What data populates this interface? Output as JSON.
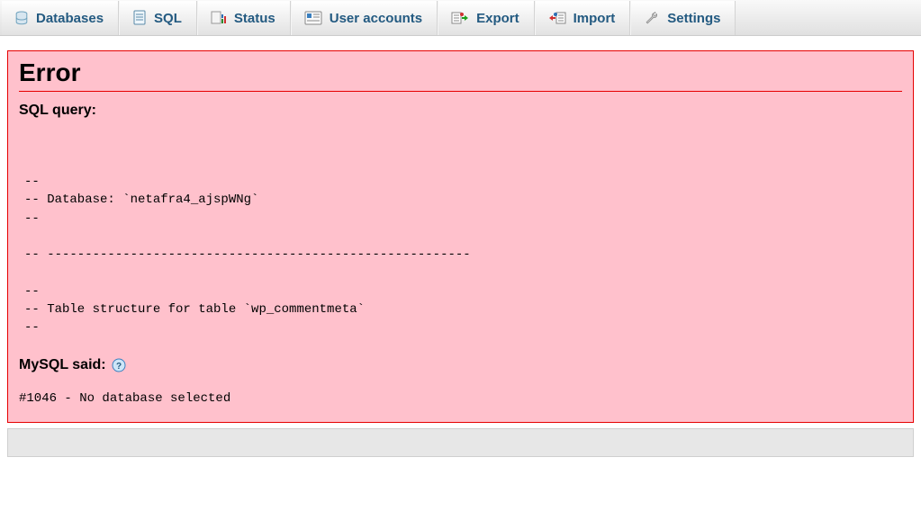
{
  "tabs": [
    {
      "id": "databases",
      "label": "Databases"
    },
    {
      "id": "sql",
      "label": "SQL"
    },
    {
      "id": "status",
      "label": "Status"
    },
    {
      "id": "useraccounts",
      "label": "User accounts"
    },
    {
      "id": "export",
      "label": "Export"
    },
    {
      "id": "import",
      "label": "Import"
    },
    {
      "id": "settings",
      "label": "Settings"
    }
  ],
  "error": {
    "heading": "Error",
    "sql_query_label": "SQL query:",
    "sql_text": "--\n-- Database: `netafra4_ajspWNg`\n--\n\n-- --------------------------------------------------------\n\n--\n-- Table structure for table `wp_commentmeta`\n--",
    "mysql_said_label": "MySQL said:",
    "mysql_message": "#1046 - No database selected"
  }
}
